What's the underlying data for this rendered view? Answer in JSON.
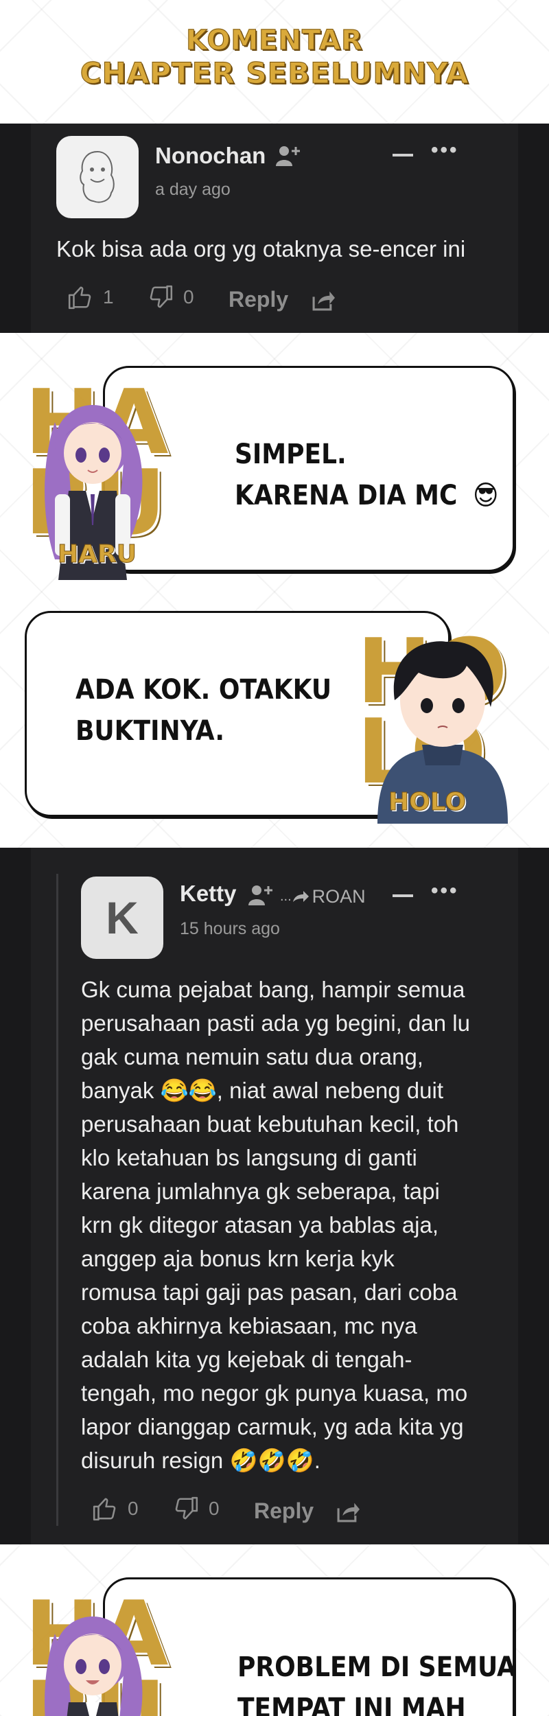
{
  "header": {
    "line1": "KOMENTAR",
    "line2": "CHAPTER SEBELUMNYA"
  },
  "comment1": {
    "username": "Nonochan",
    "time": "a day ago",
    "text": "Kok bisa ada org yg otaknya se-encer ini",
    "likes": "1",
    "dislikes": "0",
    "reply_label": "Reply"
  },
  "bubble_haru_1": {
    "lines": [
      "SIMPEL.",
      "KARENA DIA MC"
    ],
    "emoji": "😎",
    "character": "HARU",
    "letters": "HA\nRU"
  },
  "bubble_holo_1": {
    "lines": [
      "ADA KOK. OTAKKU",
      "BUKTINYA."
    ],
    "character": "HOLO",
    "letters": "HO\nLO"
  },
  "comment2": {
    "avatar_letter": "K",
    "username": "Ketty",
    "reply_to": "ROAN",
    "time": "15 hours ago",
    "lines": [
      "Gk cuma pejabat bang, hampir semua",
      "perusahaan pasti ada yg begini, dan lu",
      "gak cuma nemuin satu dua orang,",
      "banyak 😂😂, niat awal nebeng duit",
      "perusahaan buat kebutuhan kecil, toh",
      "klo ketahuan bs langsung di ganti",
      "karena jumlahnya gk seberapa, tapi",
      "krn gk ditegor atasan ya bablas aja,",
      "anggep aja bonus krn kerja kyk",
      "romusa tapi gaji pas pasan, dari coba",
      "coba akhirnya kebiasaan, mc nya",
      "adalah kita yg kejebak di tengah-",
      "tengah, mo negor gk punya kuasa, mo",
      "lapor dianggap carmuk, yg ada kita yg",
      "disuruh resign 🤣🤣🤣."
    ],
    "likes": "0",
    "dislikes": "0",
    "reply_label": "Reply"
  },
  "bubble_haru_2": {
    "lines": [
      "PROBLEM DI SEMUA",
      "TEMPAT INI MAH"
    ],
    "letters": "HA\nRU"
  },
  "colors": {
    "dark_bg": "#19191b",
    "panel": "#202022",
    "gold": "#c99a30"
  },
  "icons": [
    "add-user-icon",
    "thumbs-up-icon",
    "thumbs-down-icon",
    "share-icon",
    "reply-arrow-icon",
    "more-icon",
    "collapse-icon"
  ]
}
